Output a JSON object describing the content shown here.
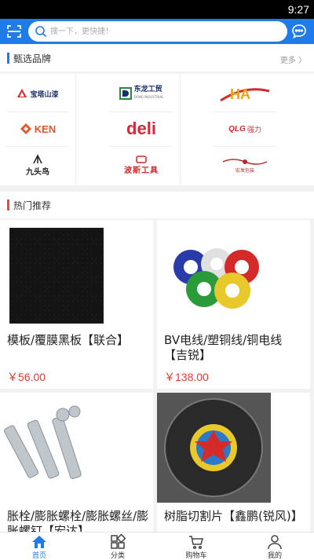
{
  "status_bar": {
    "time": "9:27"
  },
  "header": {
    "search_placeholder": "搜一下，更快捷！",
    "accent_color": "#1e7be8",
    "icons": [
      "scan-icon",
      "search-icon",
      "message-icon"
    ]
  },
  "brands": {
    "title": "甄选品牌",
    "more_label": "更多 〉",
    "items": [
      {
        "name": "宝塔山漆"
      },
      {
        "name": "东龙工贸",
        "subtitle": "DONG INDUSTRIAL"
      },
      {
        "name": "HA"
      },
      {
        "name": "KEN"
      },
      {
        "name": "deli"
      },
      {
        "name": "QLG",
        "suffix": "强力"
      },
      {
        "name": "九头鸟"
      },
      {
        "name": "波斯工具"
      },
      {
        "name": "宏发包装"
      }
    ]
  },
  "hot": {
    "title": "热门推荐",
    "accent_color": "#e8493f",
    "products": [
      {
        "name": "模板/覆膜黑板【联合】",
        "price": "￥56.00"
      },
      {
        "name": "BV电线/塑铜线/铜电线【吉锐】",
        "price": "￥138.00"
      },
      {
        "name": "胀栓/膨胀螺栓/膨胀螺丝/膨胀螺钉【宏达】",
        "price": ""
      },
      {
        "name": "树脂切割片【鑫鹏(锐风)】",
        "price": ""
      }
    ]
  },
  "tabbar": {
    "items": [
      {
        "label": "首页",
        "icon": "home-icon",
        "active": true
      },
      {
        "label": "分类",
        "icon": "category-icon",
        "active": false
      },
      {
        "label": "购物车",
        "icon": "cart-icon",
        "active": false
      },
      {
        "label": "我的",
        "icon": "profile-icon",
        "active": false
      }
    ]
  }
}
